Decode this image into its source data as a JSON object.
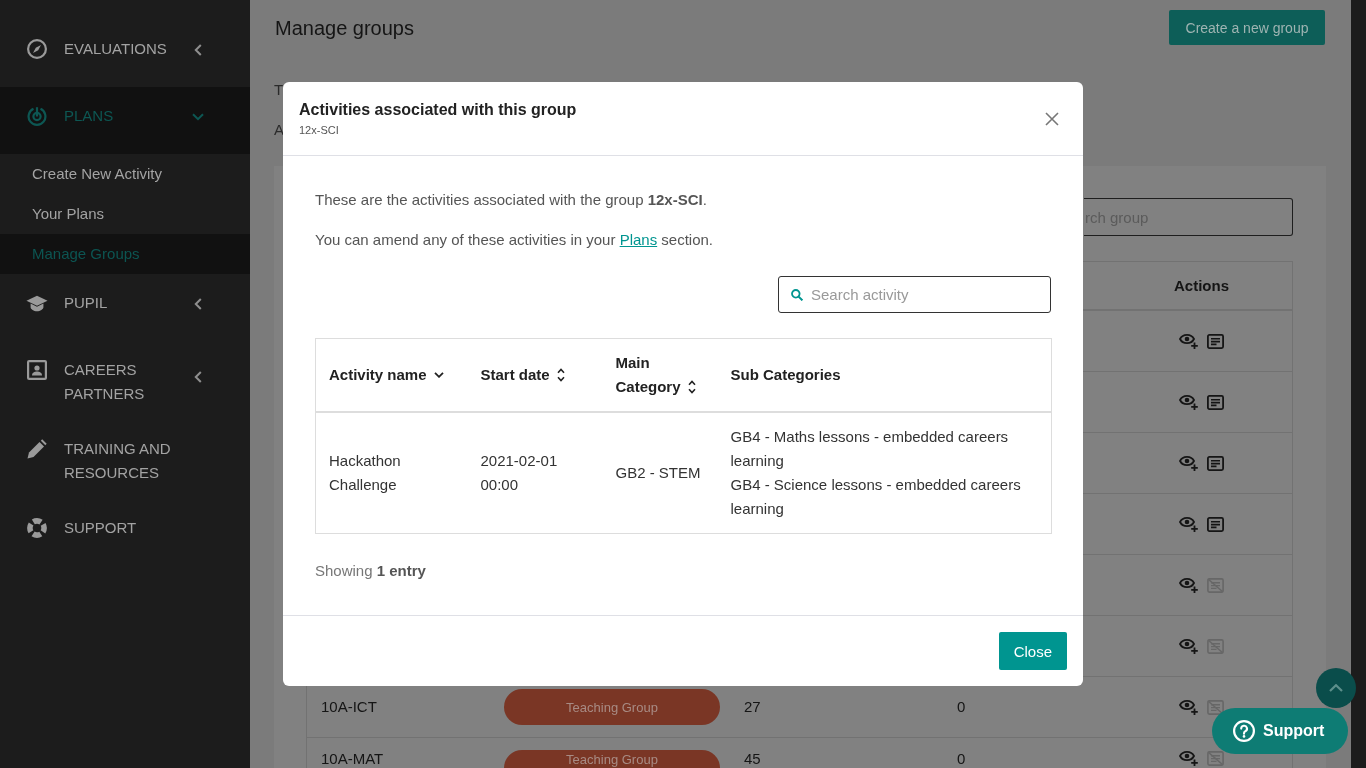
{
  "sidebar": {
    "items": [
      {
        "label": "EVALUATIONS",
        "selected": false,
        "expanded": false
      },
      {
        "label": "PLANS",
        "selected": true,
        "expanded": true,
        "children": [
          {
            "label": "Create New Activity",
            "selected": false
          },
          {
            "label": "Your Plans",
            "selected": false
          },
          {
            "label": "Manage Groups",
            "selected": true
          }
        ]
      },
      {
        "label": "PUPIL",
        "selected": false,
        "expanded": false
      },
      {
        "label": "CAREERS PARTNERS",
        "selected": false,
        "expanded": false
      },
      {
        "label": "TRAINING AND RESOURCES",
        "selected": false
      },
      {
        "label": "SUPPORT",
        "selected": false
      }
    ]
  },
  "page": {
    "title": "Manage groups",
    "create_button": "Create a new group",
    "intro_fragments": [
      "T",
      "A"
    ],
    "search": {
      "placeholder": "rch group"
    },
    "table": {
      "actions_header": "Actions",
      "rows": [
        {
          "report_available": true
        },
        {
          "report_available": true
        },
        {
          "report_available": true
        },
        {
          "report_available": true
        },
        {
          "report_available": false
        },
        {
          "report_available": false
        },
        {
          "column_1": "10A-ICT",
          "column_2": "Teaching Group",
          "column_3": "27",
          "column_4": "0",
          "report_available": false
        },
        {
          "column_1": "10A-MAT",
          "column_2": "Teaching Group",
          "column_3": "45",
          "column_4": "0",
          "report_available": false
        }
      ]
    }
  },
  "modal": {
    "title": "Activities associated with this group",
    "subtitle": "12x-SCI",
    "intro": "These are the activities associated with the group **12x-SCI**.",
    "amend_note": {
      "before": "You can amend any of these activities in your ",
      "link": "Plans",
      "after": " section."
    },
    "search": {
      "placeholder": "Search activity"
    },
    "table": {
      "columns": [
        {
          "label": "Activity name",
          "sortable": true,
          "sorted": true
        },
        {
          "label": "Start date",
          "sortable": true,
          "sorted": false
        },
        {
          "label": "Main Category",
          "sortable": true,
          "sorted": false
        },
        {
          "label": "Sub Categories",
          "sortable": false
        }
      ],
      "rows": [
        {
          "activity_name": "Hackathon Challenge",
          "start_date": "2021-02-01 00:00",
          "main_category": "GB2 - STEM",
          "sub_categories": [
            "GB4 - Maths lessons - embedded careers learning",
            "GB4 - Science lessons - embedded careers learning"
          ]
        }
      ]
    },
    "footer_note": "Showing **1 entry**",
    "close_button": "Close"
  },
  "support_button": {
    "label": "Support"
  }
}
